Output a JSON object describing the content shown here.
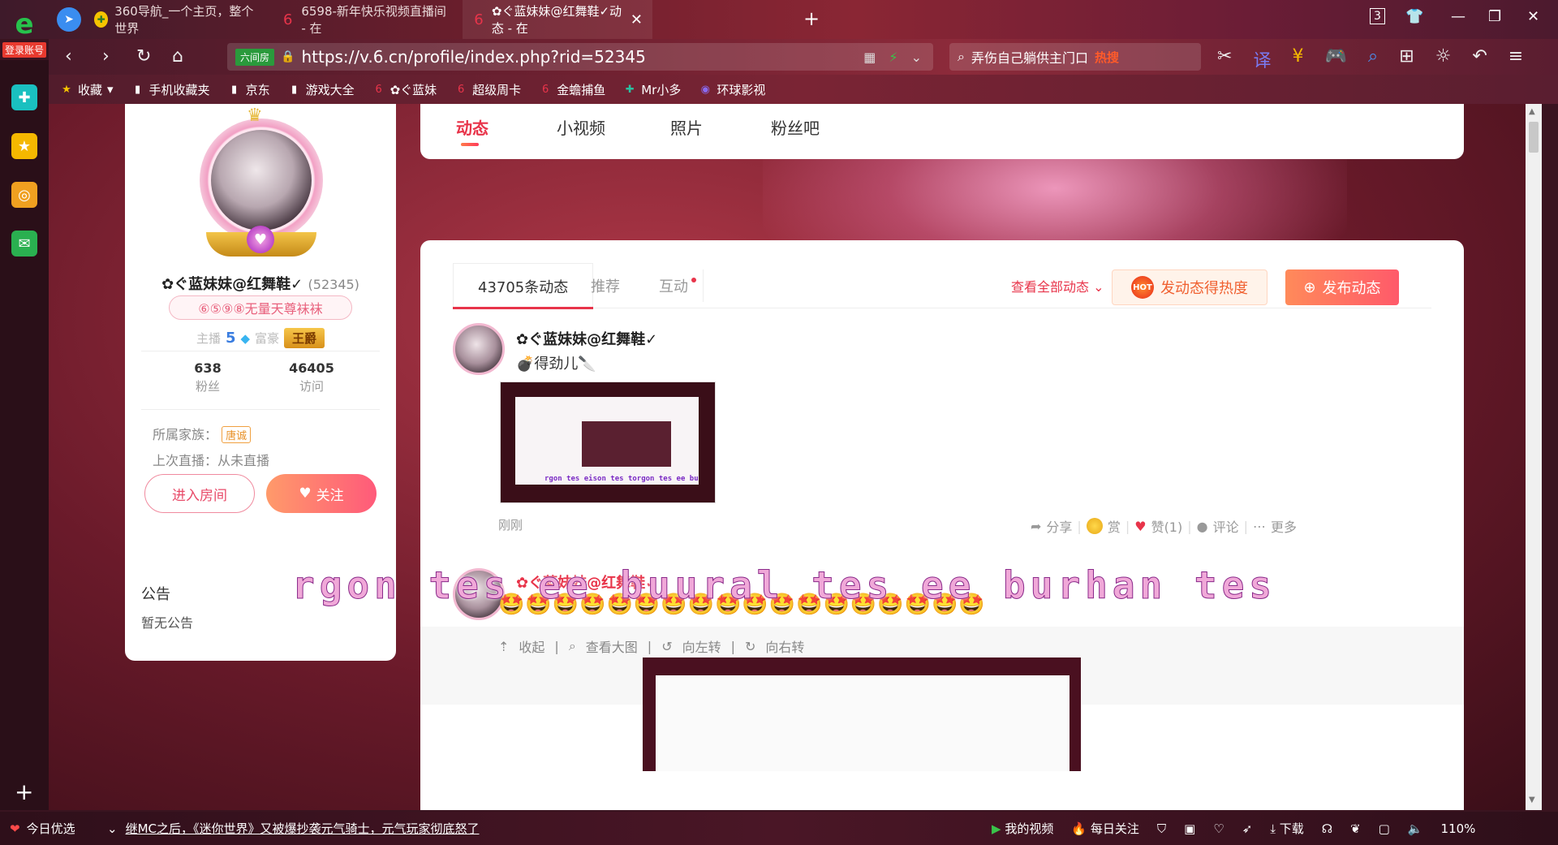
{
  "browser": {
    "login_label": "登录账号",
    "tabs": [
      {
        "title": "360导航_一个主页，整个世界",
        "icon": "360-nav-icon",
        "color": "#f5c400"
      },
      {
        "title": "6598-新年快乐视频直播间 - 在",
        "icon": "six-room-icon",
        "color": "#e8344a"
      },
      {
        "title": "✿ぐ蓝妹妹@红舞鞋✓动态 - 在",
        "icon": "six-room-icon",
        "color": "#e8344a"
      }
    ],
    "tab_count": "3",
    "url_badge": "六间房",
    "url": "https://v.6.cn/profile/index.php?rid=52345",
    "search_text": "弄伤自己躺供主门口",
    "search_hot": "热搜",
    "bookmarks": [
      {
        "label": "收藏",
        "icon": "star-icon"
      },
      {
        "label": "手机收藏夹",
        "icon": "doc-icon"
      },
      {
        "label": "京东",
        "icon": "doc-icon"
      },
      {
        "label": "游戏大全",
        "icon": "doc-icon"
      },
      {
        "label": "✿ぐ蓝妹",
        "icon": "six-room-icon"
      },
      {
        "label": "超级周卡",
        "icon": "six-room-icon"
      },
      {
        "label": "金蟾捕鱼",
        "icon": "six-room-icon"
      },
      {
        "label": "Mr小多",
        "icon": "mr-icon"
      },
      {
        "label": "环球影视",
        "icon": "globe-icon"
      }
    ]
  },
  "profile": {
    "name": "✿ぐ蓝妹妹@红舞鞋✓",
    "uid": "(52345)",
    "title_badge": "⑥⑤⑨⑧无量天尊袜袜",
    "anchor_label": "主播",
    "anchor_level": "5",
    "rich_label": "富豪",
    "rich_rank": "王爵",
    "fans_count": "638",
    "fans_label": "粉丝",
    "visits_count": "46405",
    "visits_label": "访问",
    "family_label": "所属家族：",
    "family_name": "唐诚",
    "last_live": "上次直播：从未直播",
    "enter_room": "进入房间",
    "follow": "关注"
  },
  "notice": {
    "title": "公告",
    "body": "暂无公告"
  },
  "top_nav": [
    "动态",
    "小视频",
    "照片",
    "粉丝吧"
  ],
  "feed": {
    "tabs": [
      "43705条动态",
      "推荐",
      "互动"
    ],
    "view_all": "查看全部动态",
    "heat_button": "发动态得热度",
    "hot_label": "HOT",
    "post_button": "发布动态",
    "posts": [
      {
        "author": "✿ぐ蓝妹妹@红舞鞋✓",
        "text": "得劲儿",
        "image_caption": "rgon tes eison tes torgon tes ee bu",
        "time": "刚刚",
        "actions": {
          "share": "分享",
          "reward": "赏",
          "like": "赞(1)",
          "comment": "评论",
          "more": "更多"
        }
      },
      {
        "author": "✿ぐ蓝妹妹@红舞鞋✓",
        "emoji_row": "🤩🤩🤩🤩🤩🤩🤩🤩🤩🤩🤩🤩🤩🤩🤩🤩🤩🤩",
        "tools": {
          "collapse": "收起",
          "view_large": "查看大图",
          "rotate_left": "向左转",
          "rotate_right": "向右转"
        }
      }
    ]
  },
  "overlay_caption": "rgon tes ee buural tes ee burhan tes",
  "status_bar": {
    "today": "今日优选",
    "news": "继MC之后，《迷你世界》又被爆抄袭元气骑士，元气玩家彻底怒了",
    "my_videos": "我的视频",
    "daily_follow": "每日关注",
    "download": "下载",
    "zoom": "110%"
  }
}
